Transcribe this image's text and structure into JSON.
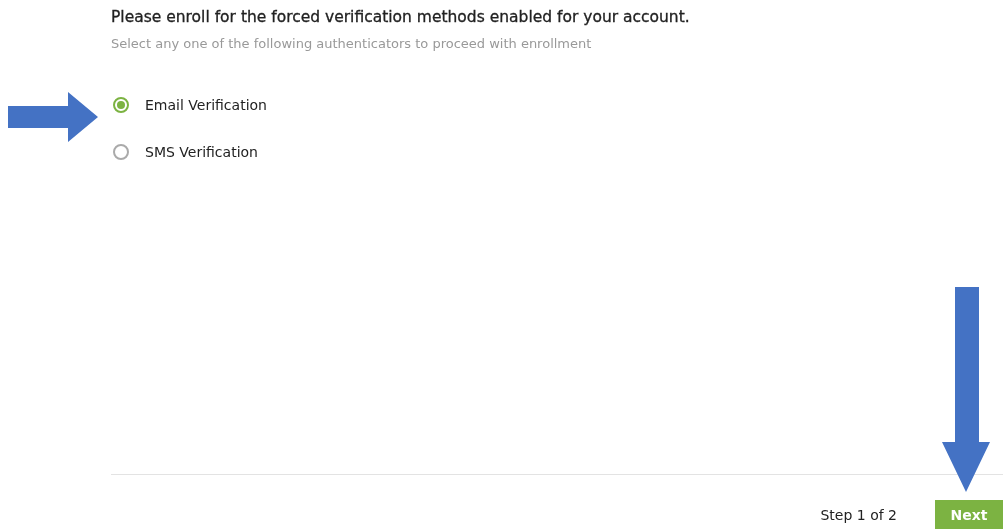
{
  "heading": "Please enroll for the forced verification methods enabled for your account.",
  "subtitle": "Select any one of the following authenticators to proceed with enrollment",
  "options": [
    {
      "label": "Email Verification",
      "selected": true
    },
    {
      "label": "SMS Verification",
      "selected": false
    }
  ],
  "footer": {
    "step": "Step 1 of 2",
    "next_button": "Next"
  }
}
